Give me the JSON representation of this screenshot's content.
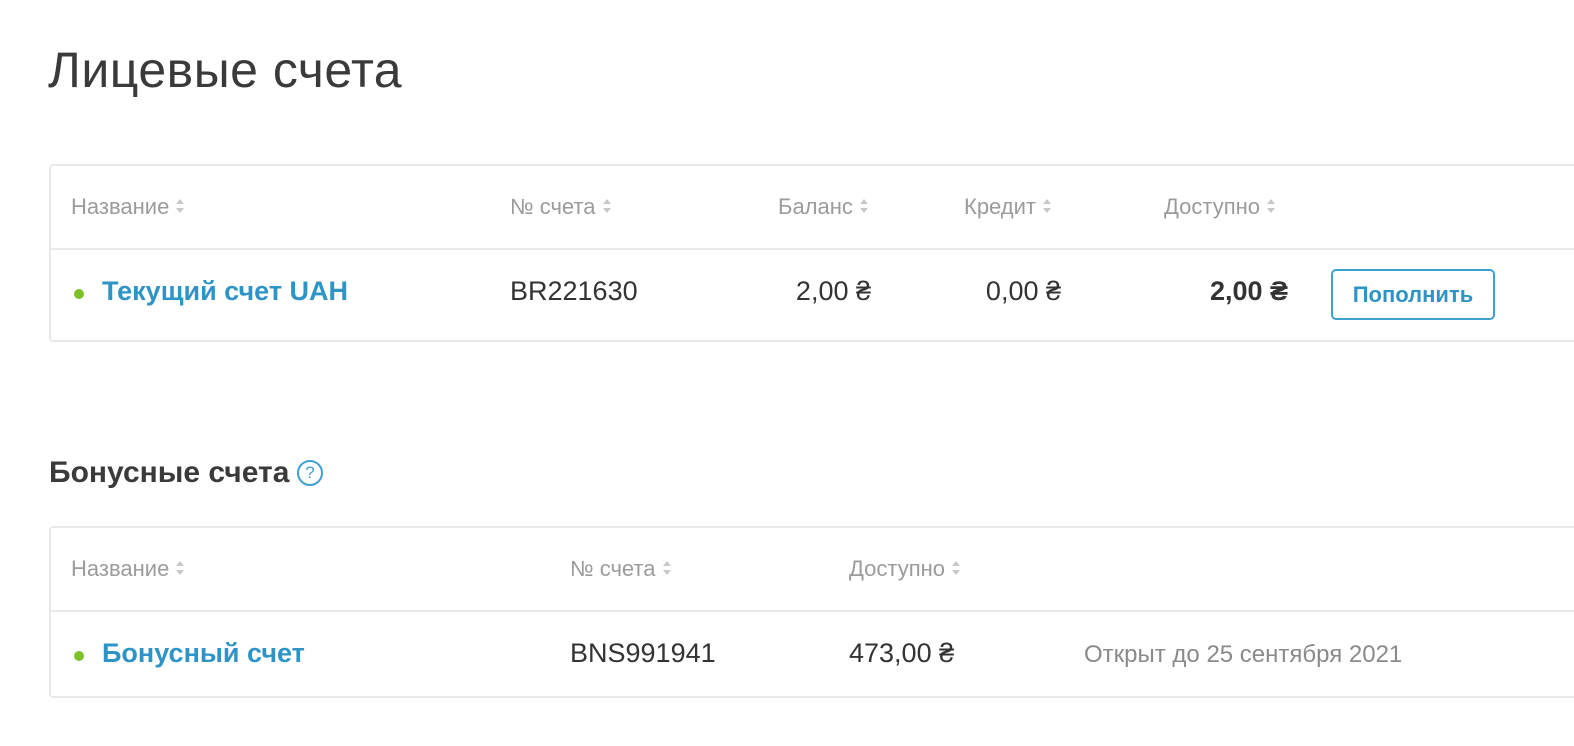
{
  "page": {
    "title": "Лицевые счета"
  },
  "accounts": {
    "headers": {
      "name": "Название",
      "number": "№ счета",
      "balance": "Баланс",
      "credit": "Кредит",
      "available": "Доступно"
    },
    "rows": [
      {
        "name": "Текущий счет UAH",
        "number": "BR221630",
        "balance": "2,00 ₴",
        "credit": "0,00 ₴",
        "available": "2,00 ₴",
        "action_label": "Пополнить",
        "status_color": "#7cc12a"
      }
    ]
  },
  "bonus": {
    "title": "Бонусные счета",
    "help_symbol": "?",
    "headers": {
      "name": "Название",
      "number": "№ счета",
      "available": "Доступно"
    },
    "rows": [
      {
        "name": "Бонусный счет",
        "number": "BNS991941",
        "available": "473,00 ₴",
        "note": "Открыт до 25 сентября 2021",
        "status_color": "#7cc12a"
      }
    ]
  },
  "colors": {
    "accent": "#2e94c6",
    "status_active": "#7cc12a",
    "header_text": "#9b9b9b",
    "border": "#e9e9e9"
  }
}
